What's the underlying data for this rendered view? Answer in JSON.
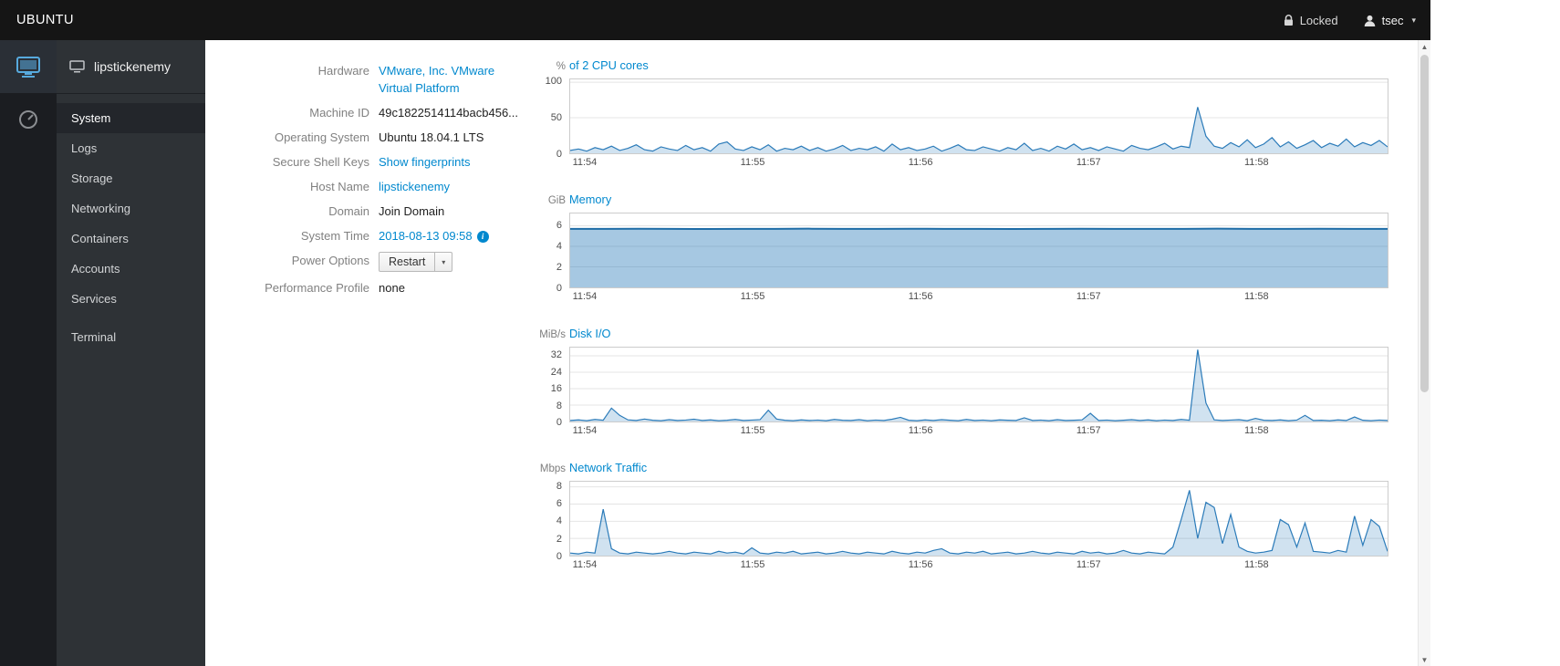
{
  "topbar": {
    "brand": "UBUNTU",
    "locked_label": "Locked",
    "user_label": "tsec"
  },
  "icons": {
    "caret_down": "▾",
    "scroll_up": "▲",
    "scroll_down": "▼",
    "info": "i"
  },
  "sidebar": {
    "host_name": "lipstickenemy",
    "active_item": "System",
    "items": [
      {
        "label": "System"
      },
      {
        "label": "Logs"
      },
      {
        "label": "Storage"
      },
      {
        "label": "Networking"
      },
      {
        "label": "Containers"
      },
      {
        "label": "Accounts"
      },
      {
        "label": "Services"
      },
      {
        "label": "Terminal"
      }
    ]
  },
  "system_info": {
    "hardware_label": "Hardware",
    "hardware_value": "VMware, Inc. VMware Virtual Platform",
    "machine_id_label": "Machine ID",
    "machine_id_value": "49c1822514114bacb456...",
    "os_label": "Operating System",
    "os_value": "Ubuntu 18.04.1 LTS",
    "ssh_label": "Secure Shell Keys",
    "ssh_value": "Show fingerprints",
    "hostname_label": "Host Name",
    "hostname_value": "lipstickenemy",
    "domain_label": "Domain",
    "domain_value": "Join Domain",
    "time_label": "System Time",
    "time_value": "2018-08-13 09:58",
    "power_label": "Power Options",
    "power_button_label": "Restart",
    "profile_label": "Performance Profile",
    "profile_value": "none"
  },
  "colors": {
    "accent_link": "#0088ce",
    "chart_line": "#2b7bb9",
    "chart_fill": "rgba(43,123,185,0.22)",
    "masthead_bg": "#151515",
    "sidebar_bg": "#2e3236",
    "iconstrip_bg": "#1b1d21"
  },
  "chart_data": [
    {
      "type": "area",
      "unit": "%",
      "title": "of 2 CPU cores",
      "ylim": [
        0,
        104
      ],
      "yticks": [
        0,
        50,
        100
      ],
      "xticks": [
        "11:54",
        "11:55",
        "11:56",
        "11:57",
        "11:58"
      ],
      "xtick_pos": [
        0.004,
        0.209,
        0.414,
        0.619,
        0.824
      ],
      "values": [
        4,
        6,
        3,
        8,
        5,
        10,
        4,
        7,
        12,
        5,
        3,
        9,
        6,
        4,
        11,
        5,
        8,
        3,
        13,
        16,
        6,
        4,
        9,
        5,
        12,
        3,
        7,
        5,
        10,
        4,
        8,
        3,
        6,
        11,
        4,
        7,
        5,
        9,
        3,
        13,
        5,
        8,
        4,
        6,
        10,
        3,
        7,
        12,
        5,
        4,
        9,
        6,
        3,
        8,
        5,
        14,
        4,
        7,
        3,
        10,
        6,
        13,
        5,
        8,
        4,
        9,
        6,
        3,
        11,
        7,
        5,
        9,
        14,
        6,
        10,
        8,
        65,
        24,
        10,
        7,
        15,
        9,
        19,
        8,
        13,
        22,
        9,
        16,
        7,
        12,
        18,
        8,
        14,
        10,
        20,
        9,
        15,
        11,
        18,
        9
      ]
    },
    {
      "type": "area",
      "unit": "GiB",
      "title": "Memory",
      "ylim": [
        0,
        7.2
      ],
      "yticks": [
        0,
        2,
        4,
        6
      ],
      "xticks": [
        "11:54",
        "11:55",
        "11:56",
        "11:57",
        "11:58"
      ],
      "xtick_pos": [
        0.004,
        0.209,
        0.414,
        0.619,
        0.824
      ],
      "values": [
        5.7,
        5.7,
        5.71,
        5.7,
        5.69,
        5.7,
        5.7,
        5.72,
        5.7,
        5.7,
        5.71,
        5.7,
        5.7,
        5.69,
        5.7,
        5.71,
        5.7,
        5.7,
        5.7,
        5.72,
        5.7,
        5.7,
        5.71,
        5.7,
        5.7
      ]
    },
    {
      "type": "area",
      "unit": "MiB/s",
      "title": "Disk I/O",
      "ylim": [
        0,
        36
      ],
      "yticks": [
        0,
        8,
        16,
        24,
        32
      ],
      "xticks": [
        "11:54",
        "11:55",
        "11:56",
        "11:57",
        "11:58"
      ],
      "xtick_pos": [
        0.004,
        0.209,
        0.414,
        0.619,
        0.824
      ],
      "values": [
        0.5,
        0.8,
        0.4,
        1.0,
        0.6,
        6.5,
        3.0,
        0.8,
        0.5,
        1.2,
        0.6,
        0.4,
        0.9,
        0.5,
        0.7,
        1.1,
        0.5,
        0.8,
        0.4,
        0.6,
        1.0,
        0.5,
        0.7,
        0.9,
        5.5,
        1.2,
        0.6,
        0.4,
        0.8,
        0.5,
        0.7,
        0.4,
        1.0,
        0.6,
        0.5,
        0.9,
        0.4,
        0.7,
        0.5,
        1.1,
        2.0,
        0.6,
        0.4,
        0.8,
        0.5,
        0.9,
        0.6,
        0.4,
        1.0,
        0.5,
        0.7,
        0.4,
        0.8,
        0.6,
        0.5,
        1.8,
        0.5,
        0.7,
        0.4,
        0.9,
        0.5,
        0.6,
        0.8,
        4.0,
        0.5,
        0.7,
        0.4,
        0.6,
        0.9,
        0.5,
        0.8,
        0.4,
        0.7,
        0.5,
        1.0,
        0.6,
        35,
        9,
        0.8,
        0.5,
        0.7,
        0.9,
        0.4,
        1.5,
        0.6,
        0.5,
        0.8,
        0.4,
        0.7,
        3.0,
        0.5,
        0.6,
        0.4,
        0.8,
        0.5,
        2.2,
        0.6,
        0.4,
        0.7,
        0.5
      ]
    },
    {
      "type": "area",
      "unit": "Mbps",
      "title": "Network Traffic",
      "ylim": [
        0,
        8.6
      ],
      "yticks": [
        0,
        2,
        4,
        6,
        8
      ],
      "xticks": [
        "11:54",
        "11:55",
        "11:56",
        "11:57",
        "11:58"
      ],
      "xtick_pos": [
        0.004,
        0.209,
        0.414,
        0.619,
        0.824
      ],
      "values": [
        0.3,
        0.2,
        0.4,
        0.3,
        5.4,
        0.8,
        0.3,
        0.2,
        0.4,
        0.3,
        0.2,
        0.3,
        0.5,
        0.3,
        0.2,
        0.4,
        0.3,
        0.2,
        0.5,
        0.3,
        0.4,
        0.2,
        0.9,
        0.3,
        0.2,
        0.4,
        0.3,
        0.5,
        0.2,
        0.3,
        0.4,
        0.2,
        0.3,
        0.5,
        0.3,
        0.2,
        0.4,
        0.3,
        0.2,
        0.5,
        0.3,
        0.2,
        0.4,
        0.3,
        0.6,
        0.8,
        0.3,
        0.2,
        0.4,
        0.3,
        0.5,
        0.2,
        0.3,
        0.4,
        0.2,
        0.3,
        0.5,
        0.3,
        0.2,
        0.4,
        0.3,
        0.2,
        0.5,
        0.3,
        0.4,
        0.2,
        0.3,
        0.6,
        0.3,
        0.2,
        0.4,
        0.3,
        0.2,
        1.0,
        4.2,
        7.6,
        2.0,
        6.2,
        5.6,
        1.4,
        4.8,
        1.0,
        0.5,
        0.3,
        0.4,
        0.6,
        4.2,
        3.6,
        1.0,
        3.8,
        0.5,
        0.4,
        0.3,
        0.6,
        0.4,
        4.6,
        1.2,
        4.2,
        3.4,
        0.5
      ]
    }
  ]
}
